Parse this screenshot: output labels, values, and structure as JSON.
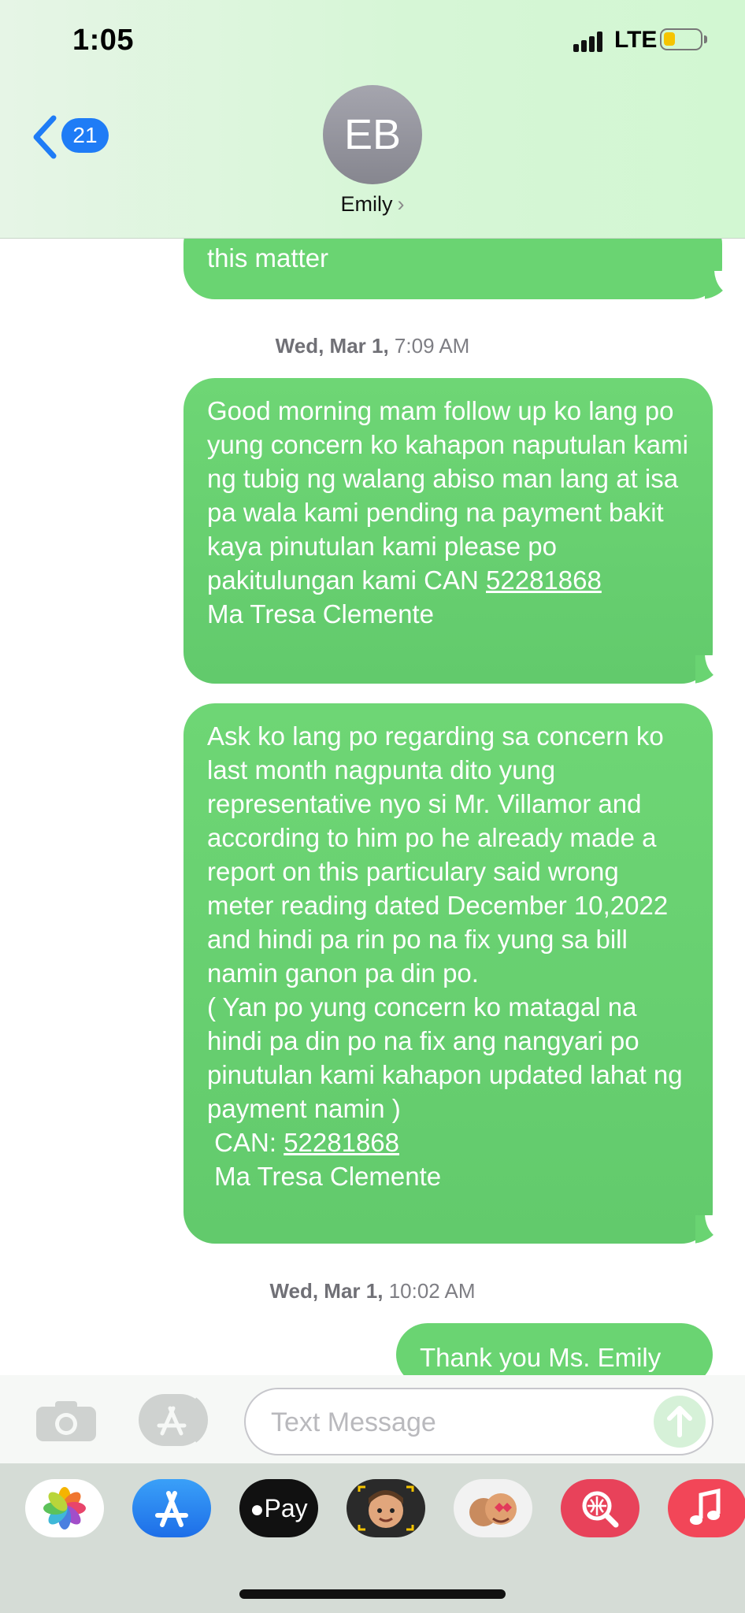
{
  "status": {
    "time": "1:05",
    "network": "LTE"
  },
  "nav": {
    "unread_count": "21",
    "avatar_initials": "EB",
    "contact_name": "Emily",
    "chevron": "›"
  },
  "messages": [
    {
      "text": "this matter"
    },
    {
      "timestamp_day": "Wed, Mar 1,",
      "timestamp_time": "7:09 AM"
    },
    {
      "lines_before": "Good morning mam follow up ko lang po yung concern ko kahapon naputulan kami ng tubig ng walang abiso man lang at isa pa wala kami pending na payment bakit kaya pinutulan kami please po pakitulungan kami CAN ",
      "link": "52281868",
      "lines_after": "Ma Tresa Clemente"
    },
    {
      "lines_before": "Ask ko lang po regarding sa concern ko last month nagpunta dito yung representative nyo si Mr. Villamor and according to him po he already made a report on this particulary said wrong meter reading dated December 10,2022 and hindi pa rin po na fix yung sa bill namin ganon pa din po.",
      "paren": "( Yan po yung concern ko matagal na hindi pa din po na fix ang nangyari po pinutulan kami kahapon updated lahat ng payment namin )",
      "can_label": " CAN: ",
      "link": "52281868",
      "lines_after": " Ma Tresa Clemente"
    },
    {
      "timestamp_day": "Wed, Mar 1,",
      "timestamp_time": "10:02 AM"
    },
    {
      "text": "Thank you Ms. Emily"
    }
  ],
  "composer": {
    "placeholder": "Text Message"
  },
  "drawer": {
    "apps": [
      "photos-icon",
      "app-store-icon",
      "apple-pay-icon",
      "memoji-icon",
      "animoji-stickers-icon",
      "search-images-icon",
      "music-icon"
    ],
    "apple_pay_label": "Pay"
  },
  "colors": {
    "bubble": "#6ad472",
    "accent": "#1f7cf6"
  }
}
